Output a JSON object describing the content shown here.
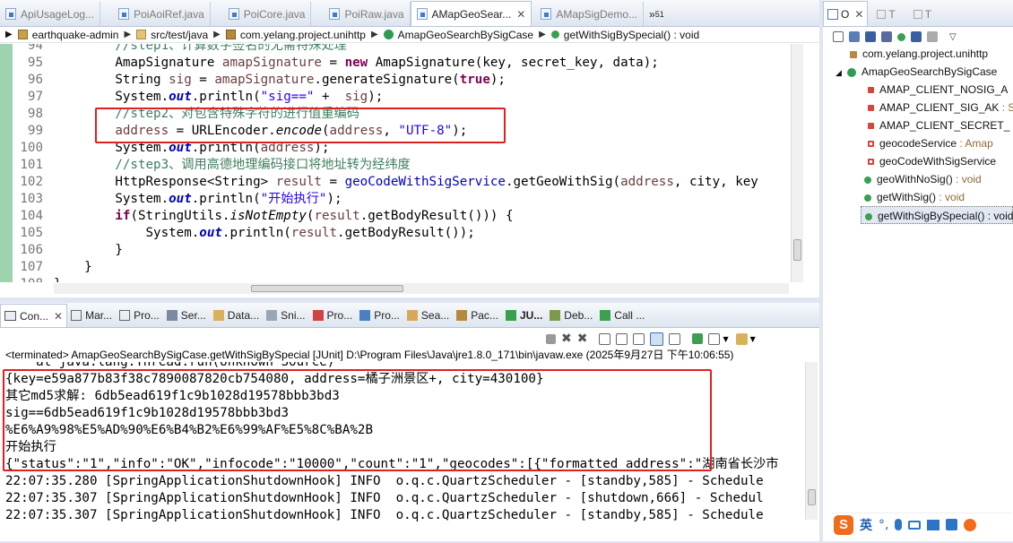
{
  "editor": {
    "tabs": [
      {
        "label": "ApiUsageLog...",
        "active": false
      },
      {
        "label": "PoiAoiRef.java",
        "active": false
      },
      {
        "label": "PoiCore.java",
        "active": false
      },
      {
        "label": "PoiRaw.java",
        "active": false
      },
      {
        "label": "AMapGeoSear...",
        "active": true
      },
      {
        "label": "AMapSigDemo...",
        "active": false
      }
    ],
    "overflow_count": "51",
    "breadcrumb": [
      "earthquake-admin",
      "src/test/java",
      "com.yelang.project.unihttp",
      "AmapGeoSearchBySigCase",
      "getWithSigBySpecial() : void"
    ],
    "lines": [
      {
        "num": "94",
        "text": "        //step1、计算数字签名的无需特殊处理"
      },
      {
        "num": "95",
        "text": "        AmapSignature amapSignature = new AmapSignature(key, secret_key, data);"
      },
      {
        "num": "96",
        "text": "        String sig = amapSignature.generateSignature(true);"
      },
      {
        "num": "97",
        "text": "        System.out.println(\"sig==\" +  sig);"
      },
      {
        "num": "98",
        "text": "        //step2、对包含特殊字符的进行值重编码"
      },
      {
        "num": "99",
        "text": "        address = URLEncoder.encode(address, \"UTF-8\");"
      },
      {
        "num": "100",
        "text": "        System.out.println(address);"
      },
      {
        "num": "101",
        "text": "        //step3、调用高德地理编码接口将地址转为经纬度"
      },
      {
        "num": "102",
        "text": "        HttpResponse<String> result = geoCodeWithSigService.getGeoWithSig(address, city, key"
      },
      {
        "num": "103",
        "text": "        System.out.println(\"开始执行\");"
      },
      {
        "num": "104",
        "text": "        if(StringUtils.isNotEmpty(result.getBodyResult())) {"
      },
      {
        "num": "105",
        "text": "            System.out.println(result.getBodyResult());"
      },
      {
        "num": "106",
        "text": "        }"
      },
      {
        "num": "107",
        "text": "    }"
      },
      {
        "num": "108",
        "text": "}"
      }
    ]
  },
  "outline": {
    "tabs": [
      "O",
      "T",
      "T"
    ],
    "items": [
      {
        "label": "com.yelang.project.unihttp",
        "type": ""
      },
      {
        "label": "AmapGeoSearchBySigCase",
        "type": ""
      },
      {
        "label": "AMAP_CLIENT_NOSIG_A",
        "type": ""
      },
      {
        "label": "AMAP_CLIENT_SIG_AK",
        "type": " : String"
      },
      {
        "label": "AMAP_CLIENT_SECRET_",
        "type": ""
      },
      {
        "label": "geocodeService",
        "type": " : Amap"
      },
      {
        "label": "geoCodeWithSigService",
        "type": ""
      },
      {
        "label": "geoWithNoSig()",
        "type": " : void"
      },
      {
        "label": "getWithSig()",
        "type": " : void"
      },
      {
        "label": "getWithSigBySpecial()",
        "type": " : void"
      }
    ]
  },
  "console": {
    "tabs": [
      "Con...",
      "Mar...",
      "Pro...",
      "Ser...",
      "Data...",
      "Sni...",
      "Pro...",
      "Pro...",
      "Sea...",
      "Pac...",
      "JU...",
      "Deb...",
      "Call ..."
    ],
    "status": "<terminated> AmapGeoSearchBySigCase.getWithSigBySpecial [JUnit] D:\\Program Files\\Java\\jre1.8.0_171\\bin\\javaw.exe (2025年9月27日 下午10:06:55)",
    "lines": [
      "    at java.lang.Thread.run(Unknown Source)",
      "{key=e59a877b83f38c7890087820cb754080, address=橘子洲景区+, city=430100}",
      "其它md5求解: 6db5ead619f1c9b1028d19578bbb3bd3",
      "sig==6db5ead619f1c9b1028d19578bbb3bd3",
      "%E6%A9%98%E5%AD%90%E6%B4%B2%E6%99%AF%E5%8C%BA%2B",
      "开始执行",
      "{\"status\":\"1\",\"info\":\"OK\",\"infocode\":\"10000\",\"count\":\"1\",\"geocodes\":[{\"formatted_address\":\"湖南省长沙市",
      "22:07:35.280 [SpringApplicationShutdownHook] INFO  o.q.c.QuartzScheduler - [standby,585] - Schedule",
      "22:07:35.307 [SpringApplicationShutdownHook] INFO  o.q.c.QuartzScheduler - [shutdown,666] - Schedul",
      "22:07:35.307 [SpringApplicationShutdownHook] INFO  o.q.c.QuartzScheduler - [standby,585] - Schedule"
    ]
  },
  "ime": {
    "label": "英"
  }
}
